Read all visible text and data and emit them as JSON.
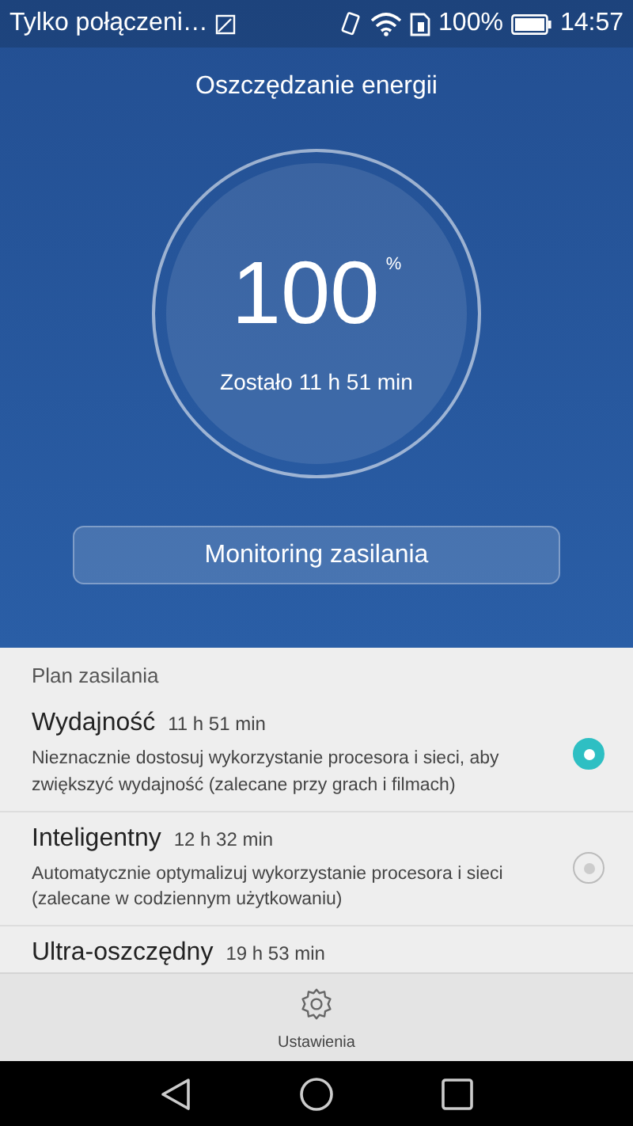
{
  "status_bar": {
    "notification": "Tylko połączeni…",
    "battery_text": "100%",
    "time": "14:57"
  },
  "header": {
    "title": "Oszczędzanie energii"
  },
  "gauge": {
    "value": "100",
    "unit": "%",
    "remaining": "Zostało 11 h 51 min"
  },
  "monitor_button": "Monitoring zasilania",
  "plans_header": "Plan zasilania",
  "plans": [
    {
      "name": "Wydajność",
      "time": "11 h 51 min",
      "description": "Nieznacznie dostosuj wykorzystanie procesora i sieci, aby zwiększyć wydajność (zalecane przy grach i filmach)",
      "selected": true
    },
    {
      "name": "Inteligentny",
      "time": "12 h 32 min",
      "description": "Automatycznie optymalizuj wykorzystanie procesora i sieci (zalecane w codziennym użytkowaniu)",
      "selected": false
    },
    {
      "name": "Ultra-oszczędny",
      "time": "19 h 53 min"
    }
  ],
  "bottom_bar": {
    "settings_label": "Ustawienia"
  }
}
